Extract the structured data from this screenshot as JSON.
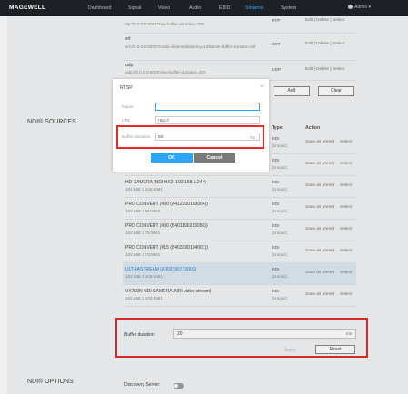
{
  "topbar": {
    "brand": "MAGEWELL",
    "nav": [
      "Dashboard",
      "Signal",
      "Video",
      "Audio",
      "EDID",
      "Streams",
      "System"
    ],
    "active_nav": "Streams",
    "user": "Admin"
  },
  "streams": {
    "rows": [
      {
        "url": "rtp://0.0.0.0:5004?mw-buffer-duration=200",
        "type": "RTP",
        "actions": "Edit | Delete | Select"
      },
      {
        "label": "srt",
        "url": "srt://0.0.0.0:5000?mode=listener&latency=125&mw-buffer-duration=60",
        "type": "SRT",
        "actions": "Edit | Delete | Select"
      },
      {
        "label": "udp",
        "url": "udp://0.0.0.0:5005?mw-buffer-duration=200",
        "type": "UDP",
        "actions": "Edit | Delete | Select"
      }
    ],
    "add_label": "Add",
    "clear_label": "Clear"
  },
  "ndi_sources": {
    "title": "NDI® SOURCES",
    "col_type": "Type",
    "col_action": "Action",
    "save_label": "Save as preset",
    "select_label": "Select",
    "rows": [
      {
        "name": "",
        "ip": "",
        "type": "NDI",
        "sub": "(Unicast)"
      },
      {
        "name": "",
        "ip": "",
        "type": "NDI",
        "sub": "(Unicast)"
      },
      {
        "name": "HD CAMERA (NDI HX2, 192.168.1.244)",
        "ip": "192.168.1.248:5961",
        "type": "NDI",
        "sub": "(Unicast)"
      },
      {
        "name": "PRO CONVERT (#00 (A412200103004))",
        "ip": "192.168.1.96:5962",
        "type": "NDI",
        "sub": "(Unicast)"
      },
      {
        "name": "PRO CONVERT (#00 (B401190213050))",
        "ip": "192.168.1.75:5961",
        "type": "NDI",
        "sub": "(Unicast)"
      },
      {
        "name": "PRO CONVERT (#15 (B403190104001))",
        "ip": "192.168.1.73:5961",
        "type": "NDI",
        "sub": "(Unicast)"
      },
      {
        "name": "ULTRASTREAM (A302190719003)",
        "ip": "192.168.1.108:5961",
        "type": "NDI",
        "sub": "(Unicast)"
      },
      {
        "name": "VX710N NDI CAMERA (NDI video stream)",
        "ip": "192.168.1.100:5961",
        "type": "NDI",
        "sub": "(Unicast)"
      }
    ],
    "buffer_label": "Buffer duration:",
    "buffer_value": "20",
    "buffer_unit": "ms",
    "apply_label": "Apply",
    "reset_label": "Reset"
  },
  "ndi_options": {
    "title": "NDI® OPTIONS",
    "discovery_label": "Discovery Server:"
  },
  "dialog": {
    "title": "RTSP",
    "close": "×",
    "name_label": "Name",
    "name_value": "",
    "url_label": "URL",
    "url_value": "rtsp://",
    "buffer_label": "Buffer duration",
    "buffer_value": "60",
    "buffer_unit": "ms",
    "ok_label": "OK",
    "cancel_label": "Cancel"
  },
  "colors": {
    "topbar": "#1d2126",
    "accent": "#2aa6ff",
    "highlight": "#e32b2b"
  }
}
